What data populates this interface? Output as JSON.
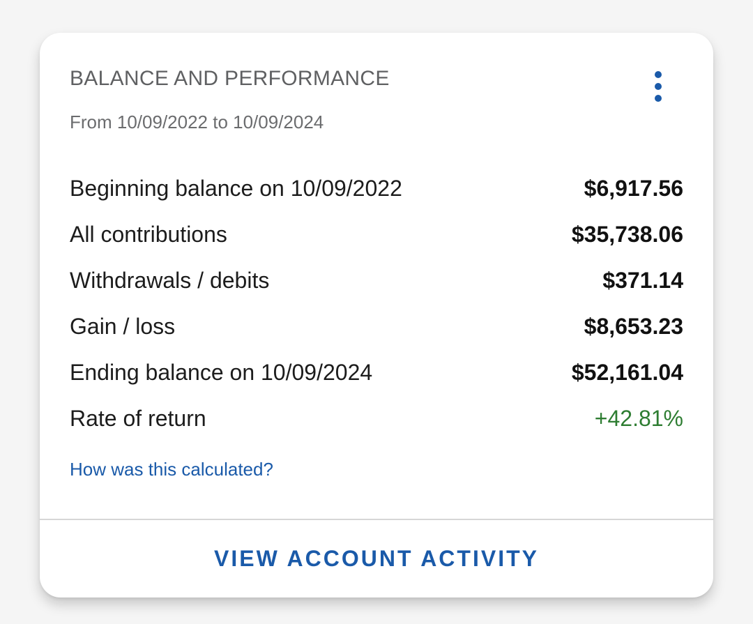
{
  "card": {
    "title": "BALANCE AND PERFORMANCE",
    "date_range": "From 10/09/2022 to 10/09/2024",
    "menu_icon": "more-vertical-icon",
    "rows": [
      {
        "label": "Beginning balance on 10/09/2022",
        "value": "$6,917.56"
      },
      {
        "label": "All contributions",
        "value": "$35,738.06"
      },
      {
        "label": "Withdrawals / debits",
        "value": "$371.14"
      },
      {
        "label": "Gain / loss",
        "value": "$8,653.23"
      },
      {
        "label": "Ending balance on 10/09/2024",
        "value": "$52,161.04"
      },
      {
        "label": "Rate of return",
        "value": "+42.81%"
      }
    ],
    "calc_link": "How was this calculated?",
    "footer_button": "VIEW ACCOUNT ACTIVITY"
  },
  "colors": {
    "accent": "#1a5aa9",
    "positive": "#2e7d32",
    "background": "#f5f5f5",
    "card": "#ffffff"
  }
}
